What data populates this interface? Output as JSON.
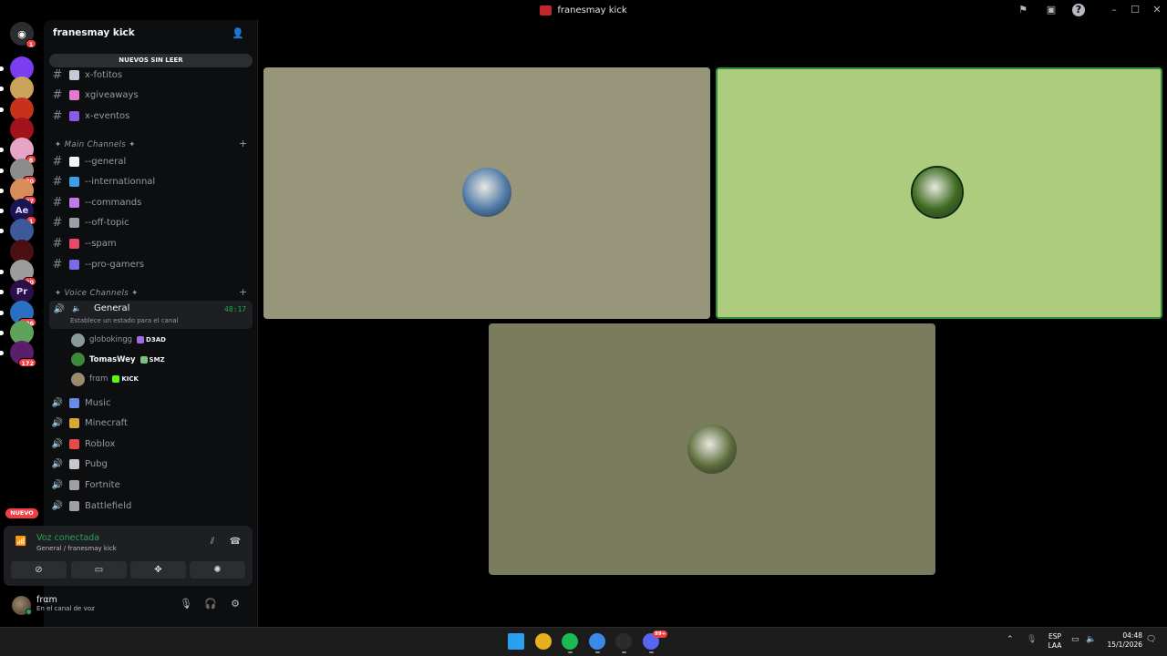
{
  "window": {
    "title": "franesmay kick",
    "controls": [
      "flag-icon",
      "inbox-icon",
      "help-icon",
      "minimize-icon",
      "maximize-icon",
      "close-icon"
    ]
  },
  "rail": {
    "home_badge": "1",
    "servers": [
      {
        "icon": "server-neon-icon",
        "color": "#7b3df0",
        "badge": "",
        "pip": true
      },
      {
        "icon": "server-photo-icon",
        "color": "#c9a35a",
        "badge": "",
        "pip": true
      },
      {
        "icon": "server-red-icon",
        "color": "#c7311e",
        "badge": "",
        "pip": true
      },
      {
        "icon": "server-star-icon",
        "color": "#a0131b",
        "badge": "",
        "pip": false
      },
      {
        "icon": "server-pink-icon",
        "color": "#e7a5c5",
        "badge": "8",
        "pip": true
      },
      {
        "icon": "server-car-icon",
        "color": "#8c8c8c",
        "badge": "80",
        "pip": true
      },
      {
        "icon": "server-girl-icon",
        "color": "#d88c5a",
        "badge": "27",
        "pip": true
      },
      {
        "icon": "server-ae-icon",
        "color": "#1a1450",
        "badge": "1",
        "pip": true,
        "label": "Ae"
      },
      {
        "icon": "server-anime-icon",
        "color": "#3c5a9a",
        "badge": "",
        "pip": true
      },
      {
        "icon": "server-dark-icon",
        "color": "#4a0f12",
        "badge": "",
        "pip": false
      },
      {
        "icon": "server-mask-icon",
        "color": "#9c9c9c",
        "badge": "20",
        "pip": true
      },
      {
        "icon": "server-pr-icon",
        "color": "#2b1048",
        "badge": "",
        "pip": true,
        "label": "Pr"
      },
      {
        "icon": "server-blue-icon",
        "color": "#2a6fc2",
        "badge": "106",
        "pip": true
      },
      {
        "icon": "server-pepe-icon",
        "color": "#5fa35a",
        "badge": "",
        "pip": true
      },
      {
        "icon": "server-ut-icon",
        "color": "#5a1f6b",
        "badge": "172",
        "pip": true
      }
    ],
    "new_label": "NUEVO"
  },
  "guild": {
    "name": "franesmay kick",
    "unread_pill": "NUEVOS SIN LEER",
    "top_channels": [
      {
        "name": "x-fotitos",
        "emoji_color": "#c8c8d8"
      },
      {
        "name": "xgiveaways",
        "emoji_color": "#e07bd0"
      },
      {
        "name": "x-eventos",
        "emoji_color": "#8a5be8"
      }
    ],
    "main_category": "✦ Main Channels ✦",
    "main_channels": [
      {
        "name": "--general",
        "emoji_color": "#f2f3f5"
      },
      {
        "name": "--internationnal",
        "emoji_color": "#3aa0e8"
      },
      {
        "name": "--commands",
        "emoji_color": "#c07be8"
      },
      {
        "name": "--off-topic",
        "emoji_color": "#9aa0a8"
      },
      {
        "name": "--spam",
        "emoji_color": "#e84a6a"
      },
      {
        "name": "--pro-gamers",
        "emoji_color": "#7a6ae8"
      }
    ],
    "voice_category": "✦ Voice Channels ✦",
    "active_voice": {
      "name": "General",
      "time": "48:17",
      "status": "Establece un estado para el canal"
    },
    "voice_users": [
      {
        "name": "globokingg",
        "tag": "D3AD",
        "tag_color": "#a06be8",
        "avatar_color": "#8a9a9c",
        "muted_text": true
      },
      {
        "name": "TomasWey",
        "tag": "SMZ",
        "tag_color": "#7fbf7f",
        "avatar_color": "#3a8a3a",
        "muted_text": false
      },
      {
        "name": "frαm",
        "tag": "KICK",
        "tag_color": "#53fc18",
        "avatar_color": "#9c8a6c",
        "muted_text": true
      }
    ],
    "voice_channels": [
      {
        "name": "Music",
        "emoji_color": "#6a8ae8"
      },
      {
        "name": "Minecraft",
        "emoji_color": "#d8a830"
      },
      {
        "name": "Roblox",
        "emoji_color": "#e84a4a"
      },
      {
        "name": "Pubg",
        "emoji_color": "#c8c8c8"
      },
      {
        "name": "Fortnite",
        "emoji_color": "#a0a0a0"
      },
      {
        "name": "Battlefield",
        "emoji_color": "#a0a0a0"
      }
    ]
  },
  "voice_panel": {
    "title": "Voz conectada",
    "subtitle": "General / franesmay kick"
  },
  "user_panel": {
    "name": "frαm",
    "status": "En el canal de voz"
  },
  "stage": {
    "tiles": [
      {
        "bg": "#97967a",
        "border": "#97967a",
        "pic_color": "#4f7aa8",
        "speaking": false
      },
      {
        "bg": "#adcc7e",
        "border": "#2f8f3f",
        "pic_color": "#3d6b1f",
        "speaking": true
      },
      {
        "bg": "#7b7b5e",
        "border": "#7b7b5e",
        "pic_color": "#5b6a3a",
        "speaking": false
      }
    ]
  },
  "taskbar": {
    "apps": [
      {
        "icon": "windows-start-icon",
        "color": "#2aa0f0",
        "running": false
      },
      {
        "icon": "chrome-icon",
        "color": "#e8b020",
        "running": false
      },
      {
        "icon": "spotify-icon",
        "color": "#1db954",
        "running": true
      },
      {
        "icon": "chrome-profile-icon",
        "color": "#3a8ae8",
        "running": true
      },
      {
        "icon": "obs-icon",
        "color": "#2b2b2b",
        "running": true
      },
      {
        "icon": "discord-icon",
        "color": "#5865f2",
        "running": true,
        "badge": "99+"
      }
    ],
    "lang_top": "ESP",
    "lang_bottom": "LAA",
    "time": "04:48",
    "date": "15/1/2026"
  }
}
